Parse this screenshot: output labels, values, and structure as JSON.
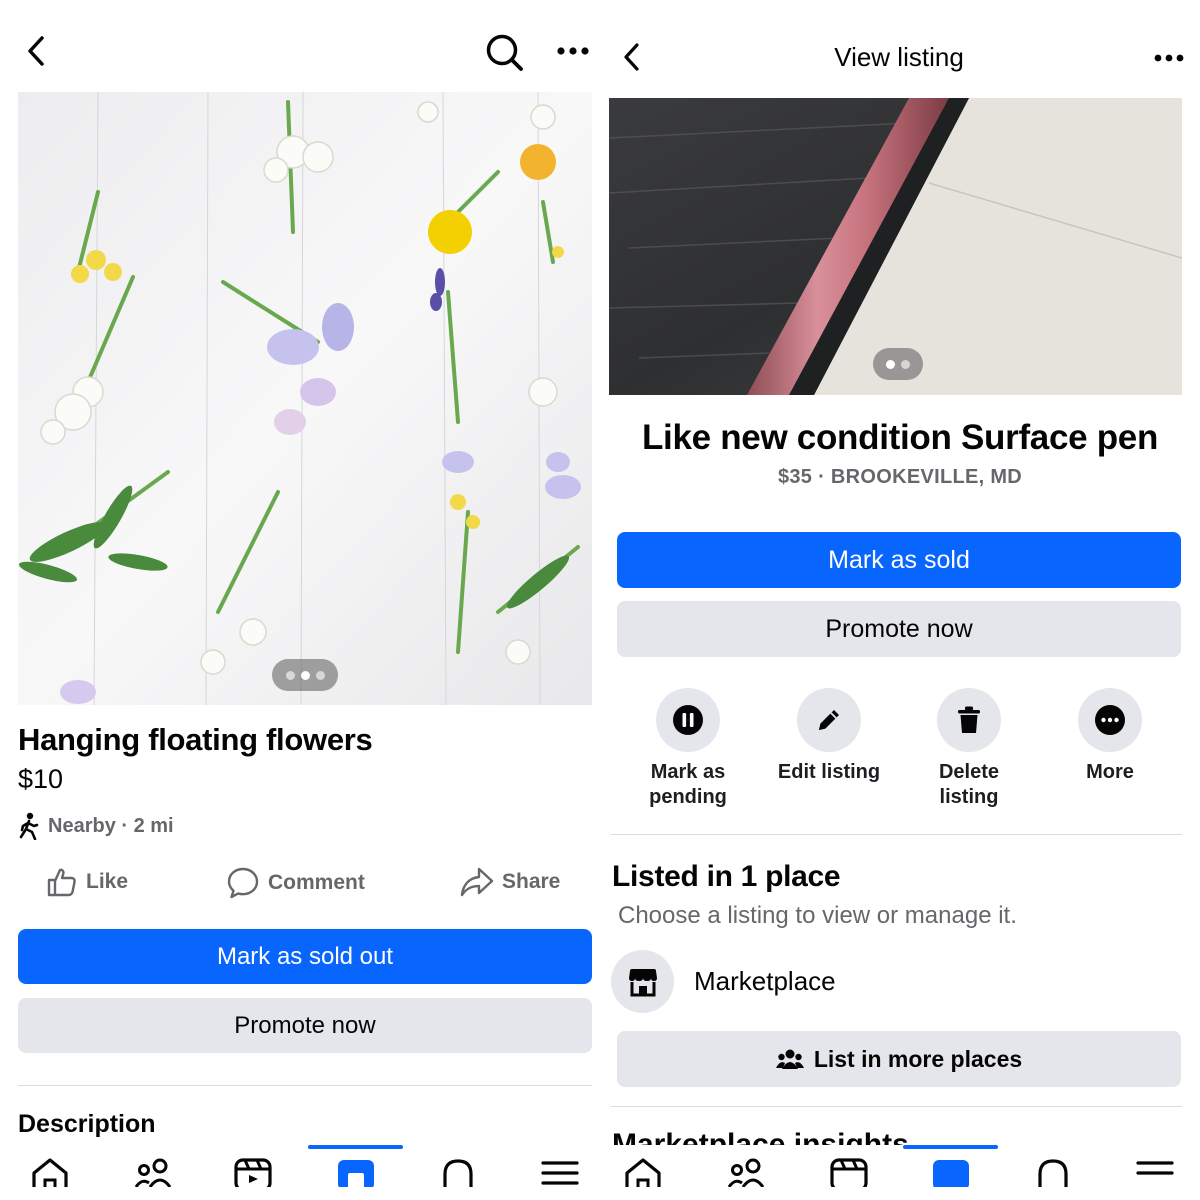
{
  "left": {
    "listing": {
      "title": "Hanging floating flowers",
      "price": "$10",
      "distance": "Nearby · 2 mi"
    },
    "reactions": {
      "like": "Like",
      "comment": "Comment",
      "share": "Share"
    },
    "buttons": {
      "mark_sold": "Mark as sold out",
      "promote": "Promote now"
    },
    "section_heading": "Description",
    "icons": {
      "back": "chevron-left-icon",
      "search": "search-icon",
      "more": "more-horizontal-icon"
    }
  },
  "right": {
    "header": {
      "title": "View listing"
    },
    "listing": {
      "title": "Like new condition Surface pen",
      "price_location": "$35 · BROOKEVILLE, MD"
    },
    "buttons": {
      "mark_sold": "Mark as sold",
      "promote": "Promote now",
      "list_more": "List in more places"
    },
    "actions": [
      {
        "label": "Mark as\npending",
        "icon": "pause-icon"
      },
      {
        "label": "Edit listing",
        "icon": "pencil-icon"
      },
      {
        "label": "Delete\nlisting",
        "icon": "trash-icon"
      },
      {
        "label": "More",
        "icon": "more-circle-icon"
      }
    ],
    "listed": {
      "heading": "Listed in 1 place",
      "subtext": "Choose a listing to view or manage it.",
      "place": "Marketplace"
    },
    "next_section": "Marketplace insights"
  },
  "tabbar": {
    "tabs": [
      "home",
      "friends",
      "video",
      "marketplace",
      "notifications",
      "menu"
    ],
    "active": "marketplace"
  },
  "colors": {
    "accent": "#0866ff",
    "secondary_button": "#e4e6eb",
    "text_secondary": "#65676b"
  }
}
